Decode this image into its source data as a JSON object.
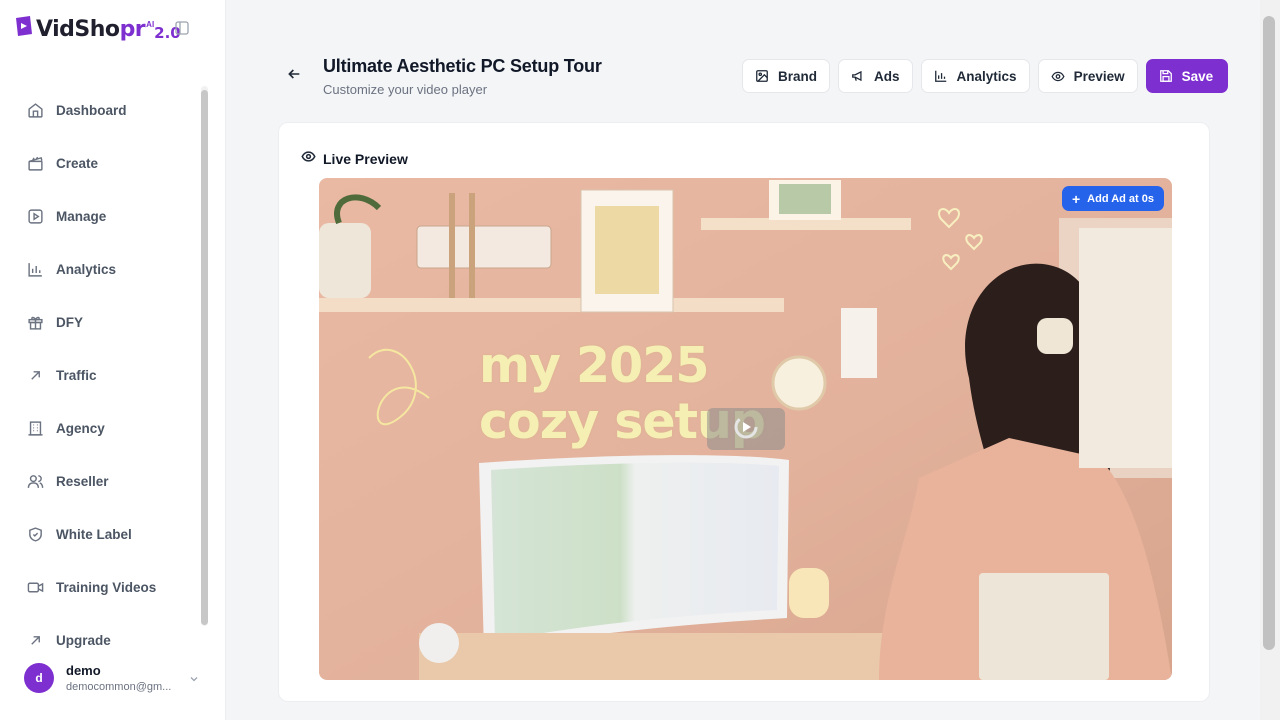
{
  "brand": {
    "name_part1": "VidSho",
    "name_part2": "pr",
    "ai": "AI",
    "version": "2.0",
    "accent": "#7e2fd0"
  },
  "sidebar": {
    "items": [
      {
        "label": "Dashboard",
        "icon": "home-icon"
      },
      {
        "label": "Create",
        "icon": "clapperboard-icon"
      },
      {
        "label": "Manage",
        "icon": "play-square-icon"
      },
      {
        "label": "Analytics",
        "icon": "bar-chart-icon"
      },
      {
        "label": "DFY",
        "icon": "gift-icon"
      },
      {
        "label": "Traffic",
        "icon": "arrow-up-right-icon"
      },
      {
        "label": "Agency",
        "icon": "building-icon"
      },
      {
        "label": "Reseller",
        "icon": "users-icon"
      },
      {
        "label": "White Label",
        "icon": "shield-icon"
      },
      {
        "label": "Training Videos",
        "icon": "video-camera-icon"
      },
      {
        "label": "Upgrade",
        "icon": "arrow-up-right-icon"
      }
    ]
  },
  "user": {
    "initial": "d",
    "name": "demo",
    "email": "democommon@gm..."
  },
  "header": {
    "title": "Ultimate Aesthetic PC Setup Tour",
    "subtitle": "Customize your video player"
  },
  "toolbar": {
    "brand": "Brand",
    "ads": "Ads",
    "analytics": "Analytics",
    "preview": "Preview",
    "save": "Save"
  },
  "preview": {
    "heading": "Live Preview",
    "add_ad": "Add Ad at 0s",
    "thumbnail_line1": "my 2025",
    "thumbnail_line2": "cozy setup"
  }
}
